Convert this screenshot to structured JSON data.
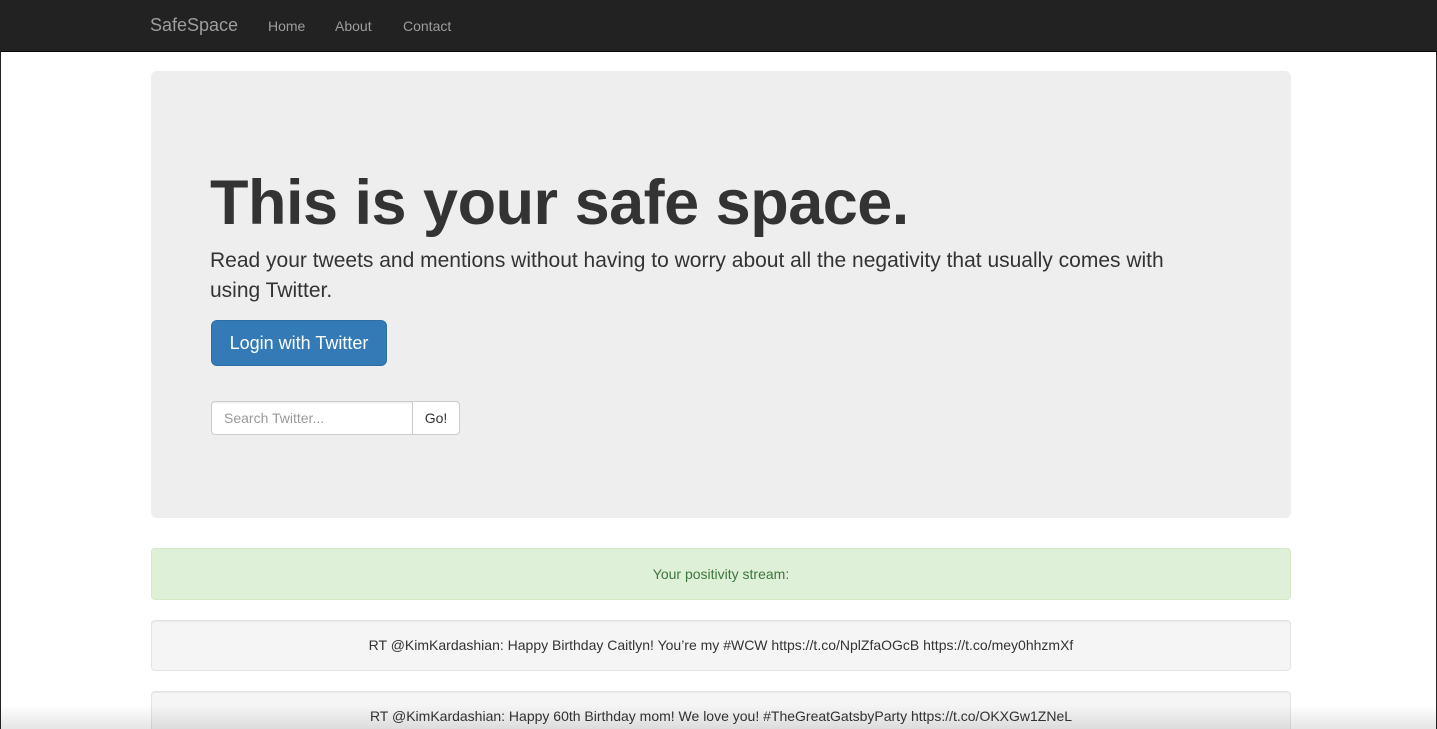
{
  "navbar": {
    "brand": "SafeSpace",
    "items": [
      {
        "label": "Home"
      },
      {
        "label": "About"
      },
      {
        "label": "Contact"
      }
    ]
  },
  "hero": {
    "title": "This is your safe space.",
    "lead": "Read your tweets and mentions without having to worry about all the negativity that usually comes with using Twitter.",
    "login_label": "Login with Twitter"
  },
  "search": {
    "placeholder": "Search Twitter...",
    "value": "",
    "button_label": "Go!"
  },
  "stream": {
    "header": "Your positivity stream:",
    "tweets": [
      {
        "text": "RT @KimKardashian: Happy Birthday Caitlyn! You’re my #WCW https://t.co/NplZfaOGcB https://t.co/mey0hhzmXf"
      },
      {
        "text": "RT @KimKardashian: Happy 60th Birthday mom! We love you! #TheGreatGatsbyParty https://t.co/OKXGw1ZNeL"
      }
    ]
  },
  "colors": {
    "navbar_bg": "#222222",
    "jumbotron_bg": "#eeeeee",
    "primary": "#337ab7",
    "success_bg": "#dff0d8",
    "success_text": "#3c763d"
  }
}
